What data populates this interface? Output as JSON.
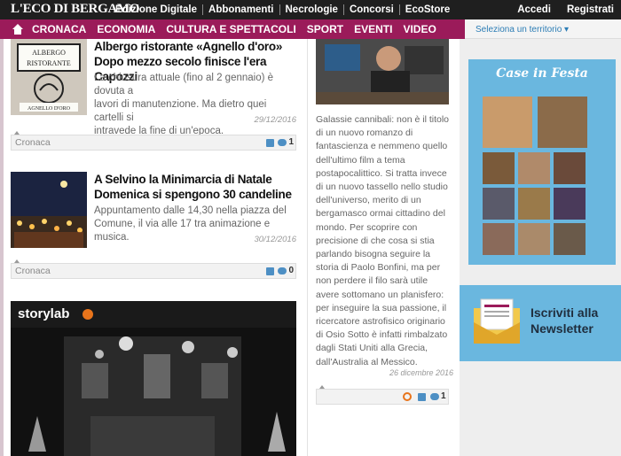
{
  "header": {
    "logo": "L'ECO DI BERGAMO",
    "links": [
      "Edizione Digitale",
      "Abbonamenti",
      "Necrologie",
      "Concorsi",
      "EcoStore"
    ],
    "accedi": "Accedi",
    "registrati": "Registrati"
  },
  "nav": {
    "items": [
      "CRONACA",
      "ECONOMIA",
      "CULTURA E SPETTACOLI",
      "SPORT",
      "EVENTI",
      "VIDEO"
    ],
    "territory": "Seleziona un territorio ▾"
  },
  "articles": [
    {
      "title_line1": "Albergo ristorante «Agnello d'oro»",
      "title_line2": "Dopo mezzo secolo finisce l'era Capozzi",
      "text_line1": "La chiusura attuale (fino al 2 gennaio) è dovuta a",
      "text_line2": "lavori di manutenzione. Ma dietro quei cartelli si",
      "text_line3": "intravede la fine di un'epoca.",
      "date": "29/12/2016",
      "category": "Cronaca",
      "comments": "1"
    },
    {
      "title_line1": "A Selvino la Minimarcia di Natale",
      "title_line2": "Domenica si spengono 30 candeline",
      "text_line1": "Appuntamento dalle 14,30 nella piazza del",
      "text_line2": "Comune, il via alle 17 tra animazione e musica.",
      "date": "30/12/2016",
      "category": "Cronaca",
      "comments": "0"
    }
  ],
  "storylab": {
    "logo": "storylab"
  },
  "feature": {
    "lines": [
      "Galassie cannibali: non è il titolo",
      "di un nuovo romanzo di",
      "fantascienza e nemmeno quello",
      "dell'ultimo film a tema",
      "postapocalittico. Si tratta invece",
      "di un nuovo tassello nello studio",
      "dell'universo, merito di un",
      "bergamasco ormai cittadino del",
      "mondo. Per scoprire con",
      "precisione di che cosa si stia",
      "parlando bisogna seguire la",
      "storia di Paolo Bonfini, ma per",
      "non perdere il filo sarà utile",
      "avere sottomano un planisfero:",
      "per inseguire la sua passione, il",
      "ricercatore astrofisico originario",
      "di Osio Sotto è infatti rimbalzato",
      "dagli Stati Uniti alla Grecia,",
      "dall'Australia al Messico."
    ],
    "date": "26 dicembre 2016",
    "comments": "1"
  },
  "sidebar": {
    "case_in_festa": "Case in Festa",
    "newsletter_line1": "Iscriviti alla",
    "newsletter_line2": "Newsletter"
  },
  "icons": {
    "home": "home-icon",
    "like": "thumbs-up-icon",
    "comment": "comment-icon",
    "clock": "clock-icon",
    "newsletter": "envelope-icon"
  },
  "colors": {
    "topbar": "#1f1f1f",
    "nav": "#9b1b5a",
    "accent_blue": "#6ab7df",
    "link_blue": "#2c7db5"
  }
}
